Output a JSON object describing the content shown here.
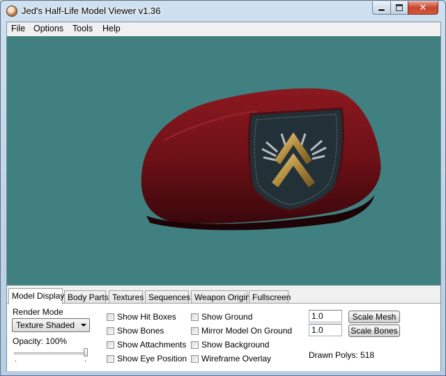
{
  "window": {
    "title": "Jed's Half-Life Model Viewer v1.36",
    "icon": "app-icon"
  },
  "menu": [
    "File",
    "Options",
    "Tools",
    "Help"
  ],
  "viewport": {
    "background": "#408080",
    "model": "beret-icon"
  },
  "tabs": [
    "Model Display",
    "Body Parts",
    "Textures",
    "Sequences",
    "Weapon Origin",
    "Fullscreen"
  ],
  "active_tab": "Model Display",
  "model_display": {
    "render_mode_label": "Render Mode",
    "render_mode_value": "Texture Shaded",
    "opacity_label": "Opacity: 100%",
    "opacity_value": 1.0,
    "checkboxes_col1": [
      "Show Hit Boxes",
      "Show Bones",
      "Show Attachments",
      "Show Eye Position"
    ],
    "checkboxes_col2": [
      "Show Ground",
      "Mirror Model On Ground",
      "Show Background",
      "Wireframe Overlay"
    ],
    "scale_mesh_value": "1.0",
    "scale_bones_value": "1.0",
    "scale_mesh_label": "Scale Mesh",
    "scale_bones_label": "Scale Bones",
    "drawn_polys": "Drawn Polys: 518"
  }
}
